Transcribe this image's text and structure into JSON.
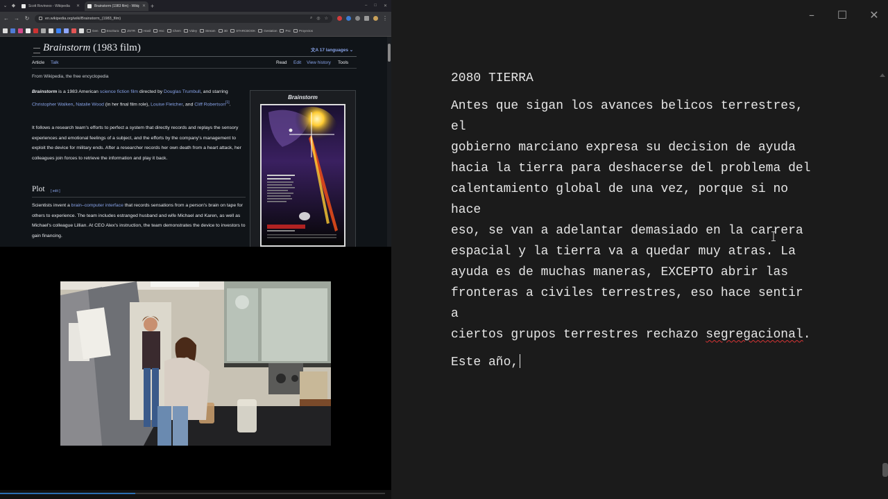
{
  "browser": {
    "tabs": [
      {
        "title": "Scott Rovinexo - Wikipedia",
        "active": false
      },
      {
        "title": "Brainstorm (1983 film) - Wikipedia",
        "active": true
      }
    ],
    "url": "en.wikipedia.org/wiki/Brainstorm_(1983_film)",
    "bookmark_folders": [
      "Gen",
      "Escritura",
      "ZSTR",
      "Hasil",
      "Hsc",
      "Chem",
      "Videy",
      "Stream",
      "3D",
      "STARCBOOK",
      "Gestation",
      "Psc",
      "Proyectos"
    ]
  },
  "wiki": {
    "title_italic": "Brainstorm",
    "title_rest": " (1983 film)",
    "languages": "17 languages",
    "tab_article": "Article",
    "tab_talk": "Talk",
    "tab_read": "Read",
    "tab_edit": "Edit",
    "tab_history": "View history",
    "tab_tools": "Tools",
    "from": "From Wikipedia, the free encyclopedia",
    "intro": {
      "bold": "Brainstorm",
      "t1": " is a 1983 American ",
      "l1": "science fiction film",
      "t2": " directed by ",
      "l2": "Douglas Trumbull",
      "t3": ", and starring ",
      "l3": "Christopher Walken",
      "t4": ", ",
      "l4": "Natalie Wood",
      "t5": " (in her final film role), ",
      "l5": "Louise Fletcher",
      "t6": ", and ",
      "l6": "Cliff Robertson",
      "t7": ".",
      "ref": "[1]"
    },
    "para2": "It follows a research team's efforts to perfect a system that directly records and replays the sensory experiences and emotional feelings of a subject, and the efforts by the company's management to exploit the device for military ends. After a researcher records her own death from a heart attack, her colleagues join forces to retrieve the information and play it back.",
    "plot_heading": "Plot",
    "plot_edit": "[ edit ]",
    "plot_para": {
      "t1": "Scientists invent a ",
      "l1": "brain–computer interface",
      "t2": " that records sensations from a person's brain on tape for others to experience. The team includes estranged husband and wife Michael and Karen, as well as Michael's colleague Lillian. At CEO Alex's instruction, the team demonstrates the device to investors to gain financing."
    },
    "infobox_title": "Brainstorm"
  },
  "editor": {
    "heading": "2080 TIERRA",
    "body": "Antes que sigan los avances belicos terrestres, el\ngobierno marciano expresa su decision de ayuda\nhacia la tierra para deshacerse del problema del\ncalentamiento global de una vez, porque si no hace\neso, se van a adelantar demasiado en la carrera\nespacial y la tierra va a quedar muy atras. La\nayuda es de muchas maneras, EXCEPTO abrir las\nfronteras a civiles terrestres, eso hace sentir a\nciertos grupos terrestres rechazo ",
    "misspelled": "segregacional",
    "body_end": ".",
    "typing": "Este año,"
  }
}
